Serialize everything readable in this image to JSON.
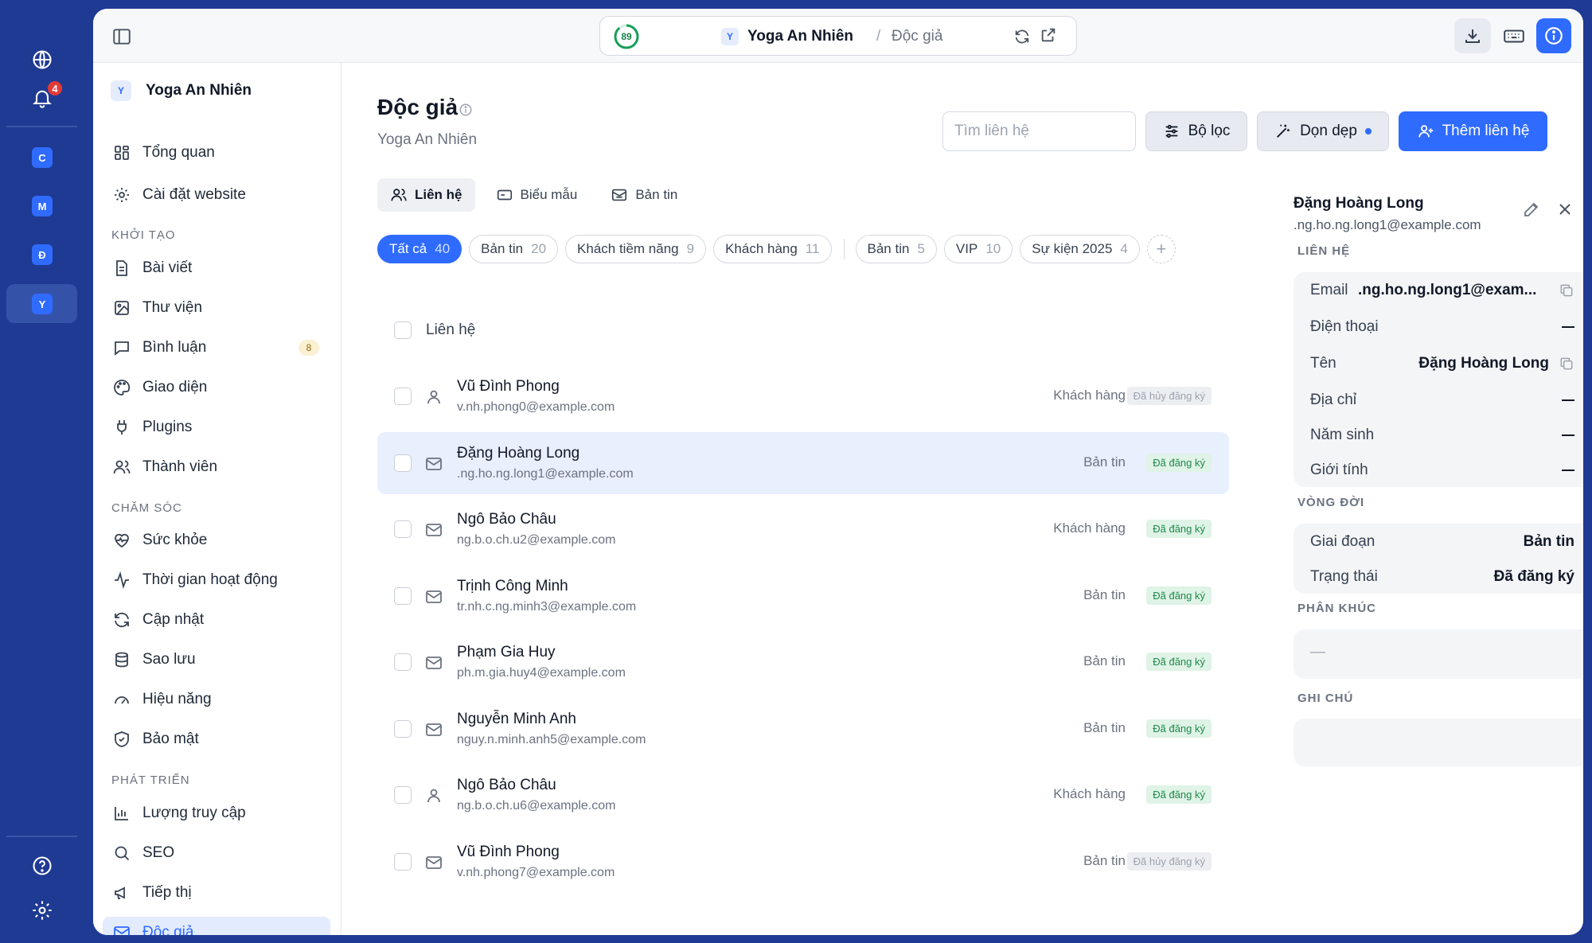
{
  "rail": {
    "notification_count": "4",
    "sites": [
      "C",
      "M",
      "Đ",
      "Y"
    ]
  },
  "topbar": {
    "score": "89",
    "site_letter": "Y",
    "site_name": "Yoga An Nhiên",
    "separator": "/",
    "page_name": "Độc giả"
  },
  "sidebar": {
    "site_letter": "Y",
    "site_name": "Yoga An Nhiên",
    "top_items": [
      {
        "label": "Tổng quan",
        "icon": "dashboard-icon"
      },
      {
        "label": "Cài đặt website",
        "icon": "gear-icon"
      }
    ],
    "sections": [
      {
        "title": "KHỞI TẠO",
        "items": [
          {
            "label": "Bài viết",
            "icon": "document-icon"
          },
          {
            "label": "Thư viện",
            "icon": "image-icon"
          },
          {
            "label": "Bình luận",
            "icon": "comment-icon",
            "count": "8"
          },
          {
            "label": "Giao diện",
            "icon": "palette-icon"
          },
          {
            "label": "Plugins",
            "icon": "plug-icon"
          },
          {
            "label": "Thành viên",
            "icon": "users-icon"
          }
        ]
      },
      {
        "title": "CHĂM SÓC",
        "items": [
          {
            "label": "Sức khỏe",
            "icon": "heart-pulse-icon"
          },
          {
            "label": "Thời gian hoạt động",
            "icon": "activity-icon"
          },
          {
            "label": "Cập nhật",
            "icon": "refresh-icon"
          },
          {
            "label": "Sao lưu",
            "icon": "database-icon"
          },
          {
            "label": "Hiệu năng",
            "icon": "gauge-icon"
          },
          {
            "label": "Bảo mật",
            "icon": "shield-icon"
          }
        ]
      },
      {
        "title": "PHÁT TRIỂN",
        "items": [
          {
            "label": "Lượng truy cập",
            "icon": "bar-chart-icon"
          },
          {
            "label": "SEO",
            "icon": "search-icon"
          },
          {
            "label": "Tiếp thị",
            "icon": "megaphone-icon"
          },
          {
            "label": "Độc giả",
            "icon": "mail-icon",
            "active": true
          }
        ]
      }
    ]
  },
  "main": {
    "title": "Độc giả",
    "subtitle": "Yoga An Nhiên",
    "search_placeholder": "Tìm liên hệ",
    "filter_label": "Bộ lọc",
    "clean_label": "Dọn dẹp",
    "add_label": "Thêm liên hệ",
    "tabs": [
      {
        "label": "Liên hệ",
        "active": true
      },
      {
        "label": "Biểu mẫu"
      },
      {
        "label": "Bản tin"
      }
    ],
    "chips_status": [
      {
        "label": "Tất cả",
        "count": "40",
        "active": true
      },
      {
        "label": "Bản tin",
        "count": "20"
      },
      {
        "label": "Khách tiềm năng",
        "count": "9"
      },
      {
        "label": "Khách hàng",
        "count": "11"
      }
    ],
    "chips_segments": [
      {
        "label": "Bản tin",
        "count": "5"
      },
      {
        "label": "VIP",
        "count": "10"
      },
      {
        "label": "Sự kiện 2025",
        "count": "4"
      }
    ],
    "list_header": "Liên hệ",
    "contacts": [
      {
        "name": "Vũ Đình Phong",
        "email": "v.nh.phong0@example.com",
        "type": "Khách hàng",
        "status": "Đã hủy đăng ký",
        "status_kind": "gray",
        "icon": "user"
      },
      {
        "name": "Đặng Hoàng Long",
        "email": ".ng.ho.ng.long1@example.com",
        "type": "Bản tin",
        "status": "Đã đăng ký",
        "status_kind": "green",
        "icon": "mail",
        "selected": true
      },
      {
        "name": "Ngô Bảo Châu",
        "email": "ng.b.o.ch.u2@example.com",
        "type": "Khách hàng",
        "status": "Đã đăng ký",
        "status_kind": "green",
        "icon": "mail"
      },
      {
        "name": "Trịnh Công Minh",
        "email": "tr.nh.c.ng.minh3@example.com",
        "type": "Bản tin",
        "status": "Đã đăng ký",
        "status_kind": "green",
        "icon": "mail"
      },
      {
        "name": "Phạm Gia Huy",
        "email": "ph.m.gia.huy4@example.com",
        "type": "Bản tin",
        "status": "Đã đăng ký",
        "status_kind": "green",
        "icon": "mail"
      },
      {
        "name": "Nguyễn Minh Anh",
        "email": "nguy.n.minh.anh5@example.com",
        "type": "Bản tin",
        "status": "Đã đăng ký",
        "status_kind": "green",
        "icon": "mail"
      },
      {
        "name": "Ngô Bảo Châu",
        "email": "ng.b.o.ch.u6@example.com",
        "type": "Khách hàng",
        "status": "Đã đăng ký",
        "status_kind": "green",
        "icon": "user"
      },
      {
        "name": "Vũ Đình Phong",
        "email": "v.nh.phong7@example.com",
        "type": "Bản tin",
        "status": "Đã hủy đăng ký",
        "status_kind": "gray",
        "icon": "mail"
      }
    ]
  },
  "detail": {
    "name": "Đặng Hoàng Long",
    "email": ".ng.ho.ng.long1@example.com",
    "section_contact": "LIÊN HỆ",
    "contact_fields": [
      {
        "label": "Email",
        "value": ".ng.ho.ng.long1@exam...",
        "copy": true
      },
      {
        "label": "Điện thoại",
        "value": ""
      },
      {
        "label": "Tên",
        "value": "Đặng Hoàng Long",
        "copy": true
      },
      {
        "label": "Địa chỉ",
        "value": ""
      },
      {
        "label": "Năm sinh",
        "value": ""
      },
      {
        "label": "Giới tính",
        "value": ""
      }
    ],
    "section_lifecycle": "VÒNG ĐỜI",
    "lifecycle_fields": [
      {
        "label": "Giai đoạn",
        "value": "Bản tin"
      },
      {
        "label": "Trạng thái",
        "value": "Đã đăng ký"
      }
    ],
    "section_segment": "PHÂN KHÚC",
    "segment_empty": "—",
    "section_notes": "GHI CHÚ"
  },
  "colors": {
    "accent": "#2f6bff",
    "rail_bg": "#1f3a93",
    "status_green": "#1f8a4c",
    "badge_red": "#e53935"
  }
}
